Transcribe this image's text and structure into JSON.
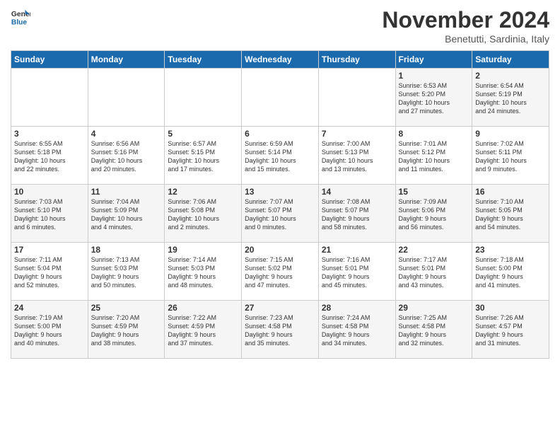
{
  "header": {
    "logo_line1": "General",
    "logo_line2": "Blue",
    "month": "November 2024",
    "location": "Benetutti, Sardinia, Italy"
  },
  "days_of_week": [
    "Sunday",
    "Monday",
    "Tuesday",
    "Wednesday",
    "Thursday",
    "Friday",
    "Saturday"
  ],
  "weeks": [
    [
      {
        "day": "",
        "info": ""
      },
      {
        "day": "",
        "info": ""
      },
      {
        "day": "",
        "info": ""
      },
      {
        "day": "",
        "info": ""
      },
      {
        "day": "",
        "info": ""
      },
      {
        "day": "1",
        "info": "Sunrise: 6:53 AM\nSunset: 5:20 PM\nDaylight: 10 hours\nand 27 minutes."
      },
      {
        "day": "2",
        "info": "Sunrise: 6:54 AM\nSunset: 5:19 PM\nDaylight: 10 hours\nand 24 minutes."
      }
    ],
    [
      {
        "day": "3",
        "info": "Sunrise: 6:55 AM\nSunset: 5:18 PM\nDaylight: 10 hours\nand 22 minutes."
      },
      {
        "day": "4",
        "info": "Sunrise: 6:56 AM\nSunset: 5:16 PM\nDaylight: 10 hours\nand 20 minutes."
      },
      {
        "day": "5",
        "info": "Sunrise: 6:57 AM\nSunset: 5:15 PM\nDaylight: 10 hours\nand 17 minutes."
      },
      {
        "day": "6",
        "info": "Sunrise: 6:59 AM\nSunset: 5:14 PM\nDaylight: 10 hours\nand 15 minutes."
      },
      {
        "day": "7",
        "info": "Sunrise: 7:00 AM\nSunset: 5:13 PM\nDaylight: 10 hours\nand 13 minutes."
      },
      {
        "day": "8",
        "info": "Sunrise: 7:01 AM\nSunset: 5:12 PM\nDaylight: 10 hours\nand 11 minutes."
      },
      {
        "day": "9",
        "info": "Sunrise: 7:02 AM\nSunset: 5:11 PM\nDaylight: 10 hours\nand 9 minutes."
      }
    ],
    [
      {
        "day": "10",
        "info": "Sunrise: 7:03 AM\nSunset: 5:10 PM\nDaylight: 10 hours\nand 6 minutes."
      },
      {
        "day": "11",
        "info": "Sunrise: 7:04 AM\nSunset: 5:09 PM\nDaylight: 10 hours\nand 4 minutes."
      },
      {
        "day": "12",
        "info": "Sunrise: 7:06 AM\nSunset: 5:08 PM\nDaylight: 10 hours\nand 2 minutes."
      },
      {
        "day": "13",
        "info": "Sunrise: 7:07 AM\nSunset: 5:07 PM\nDaylight: 10 hours\nand 0 minutes."
      },
      {
        "day": "14",
        "info": "Sunrise: 7:08 AM\nSunset: 5:07 PM\nDaylight: 9 hours\nand 58 minutes."
      },
      {
        "day": "15",
        "info": "Sunrise: 7:09 AM\nSunset: 5:06 PM\nDaylight: 9 hours\nand 56 minutes."
      },
      {
        "day": "16",
        "info": "Sunrise: 7:10 AM\nSunset: 5:05 PM\nDaylight: 9 hours\nand 54 minutes."
      }
    ],
    [
      {
        "day": "17",
        "info": "Sunrise: 7:11 AM\nSunset: 5:04 PM\nDaylight: 9 hours\nand 52 minutes."
      },
      {
        "day": "18",
        "info": "Sunrise: 7:13 AM\nSunset: 5:03 PM\nDaylight: 9 hours\nand 50 minutes."
      },
      {
        "day": "19",
        "info": "Sunrise: 7:14 AM\nSunset: 5:03 PM\nDaylight: 9 hours\nand 48 minutes."
      },
      {
        "day": "20",
        "info": "Sunrise: 7:15 AM\nSunset: 5:02 PM\nDaylight: 9 hours\nand 47 minutes."
      },
      {
        "day": "21",
        "info": "Sunrise: 7:16 AM\nSunset: 5:01 PM\nDaylight: 9 hours\nand 45 minutes."
      },
      {
        "day": "22",
        "info": "Sunrise: 7:17 AM\nSunset: 5:01 PM\nDaylight: 9 hours\nand 43 minutes."
      },
      {
        "day": "23",
        "info": "Sunrise: 7:18 AM\nSunset: 5:00 PM\nDaylight: 9 hours\nand 41 minutes."
      }
    ],
    [
      {
        "day": "24",
        "info": "Sunrise: 7:19 AM\nSunset: 5:00 PM\nDaylight: 9 hours\nand 40 minutes."
      },
      {
        "day": "25",
        "info": "Sunrise: 7:20 AM\nSunset: 4:59 PM\nDaylight: 9 hours\nand 38 minutes."
      },
      {
        "day": "26",
        "info": "Sunrise: 7:22 AM\nSunset: 4:59 PM\nDaylight: 9 hours\nand 37 minutes."
      },
      {
        "day": "27",
        "info": "Sunrise: 7:23 AM\nSunset: 4:58 PM\nDaylight: 9 hours\nand 35 minutes."
      },
      {
        "day": "28",
        "info": "Sunrise: 7:24 AM\nSunset: 4:58 PM\nDaylight: 9 hours\nand 34 minutes."
      },
      {
        "day": "29",
        "info": "Sunrise: 7:25 AM\nSunset: 4:58 PM\nDaylight: 9 hours\nand 32 minutes."
      },
      {
        "day": "30",
        "info": "Sunrise: 7:26 AM\nSunset: 4:57 PM\nDaylight: 9 hours\nand 31 minutes."
      }
    ]
  ]
}
